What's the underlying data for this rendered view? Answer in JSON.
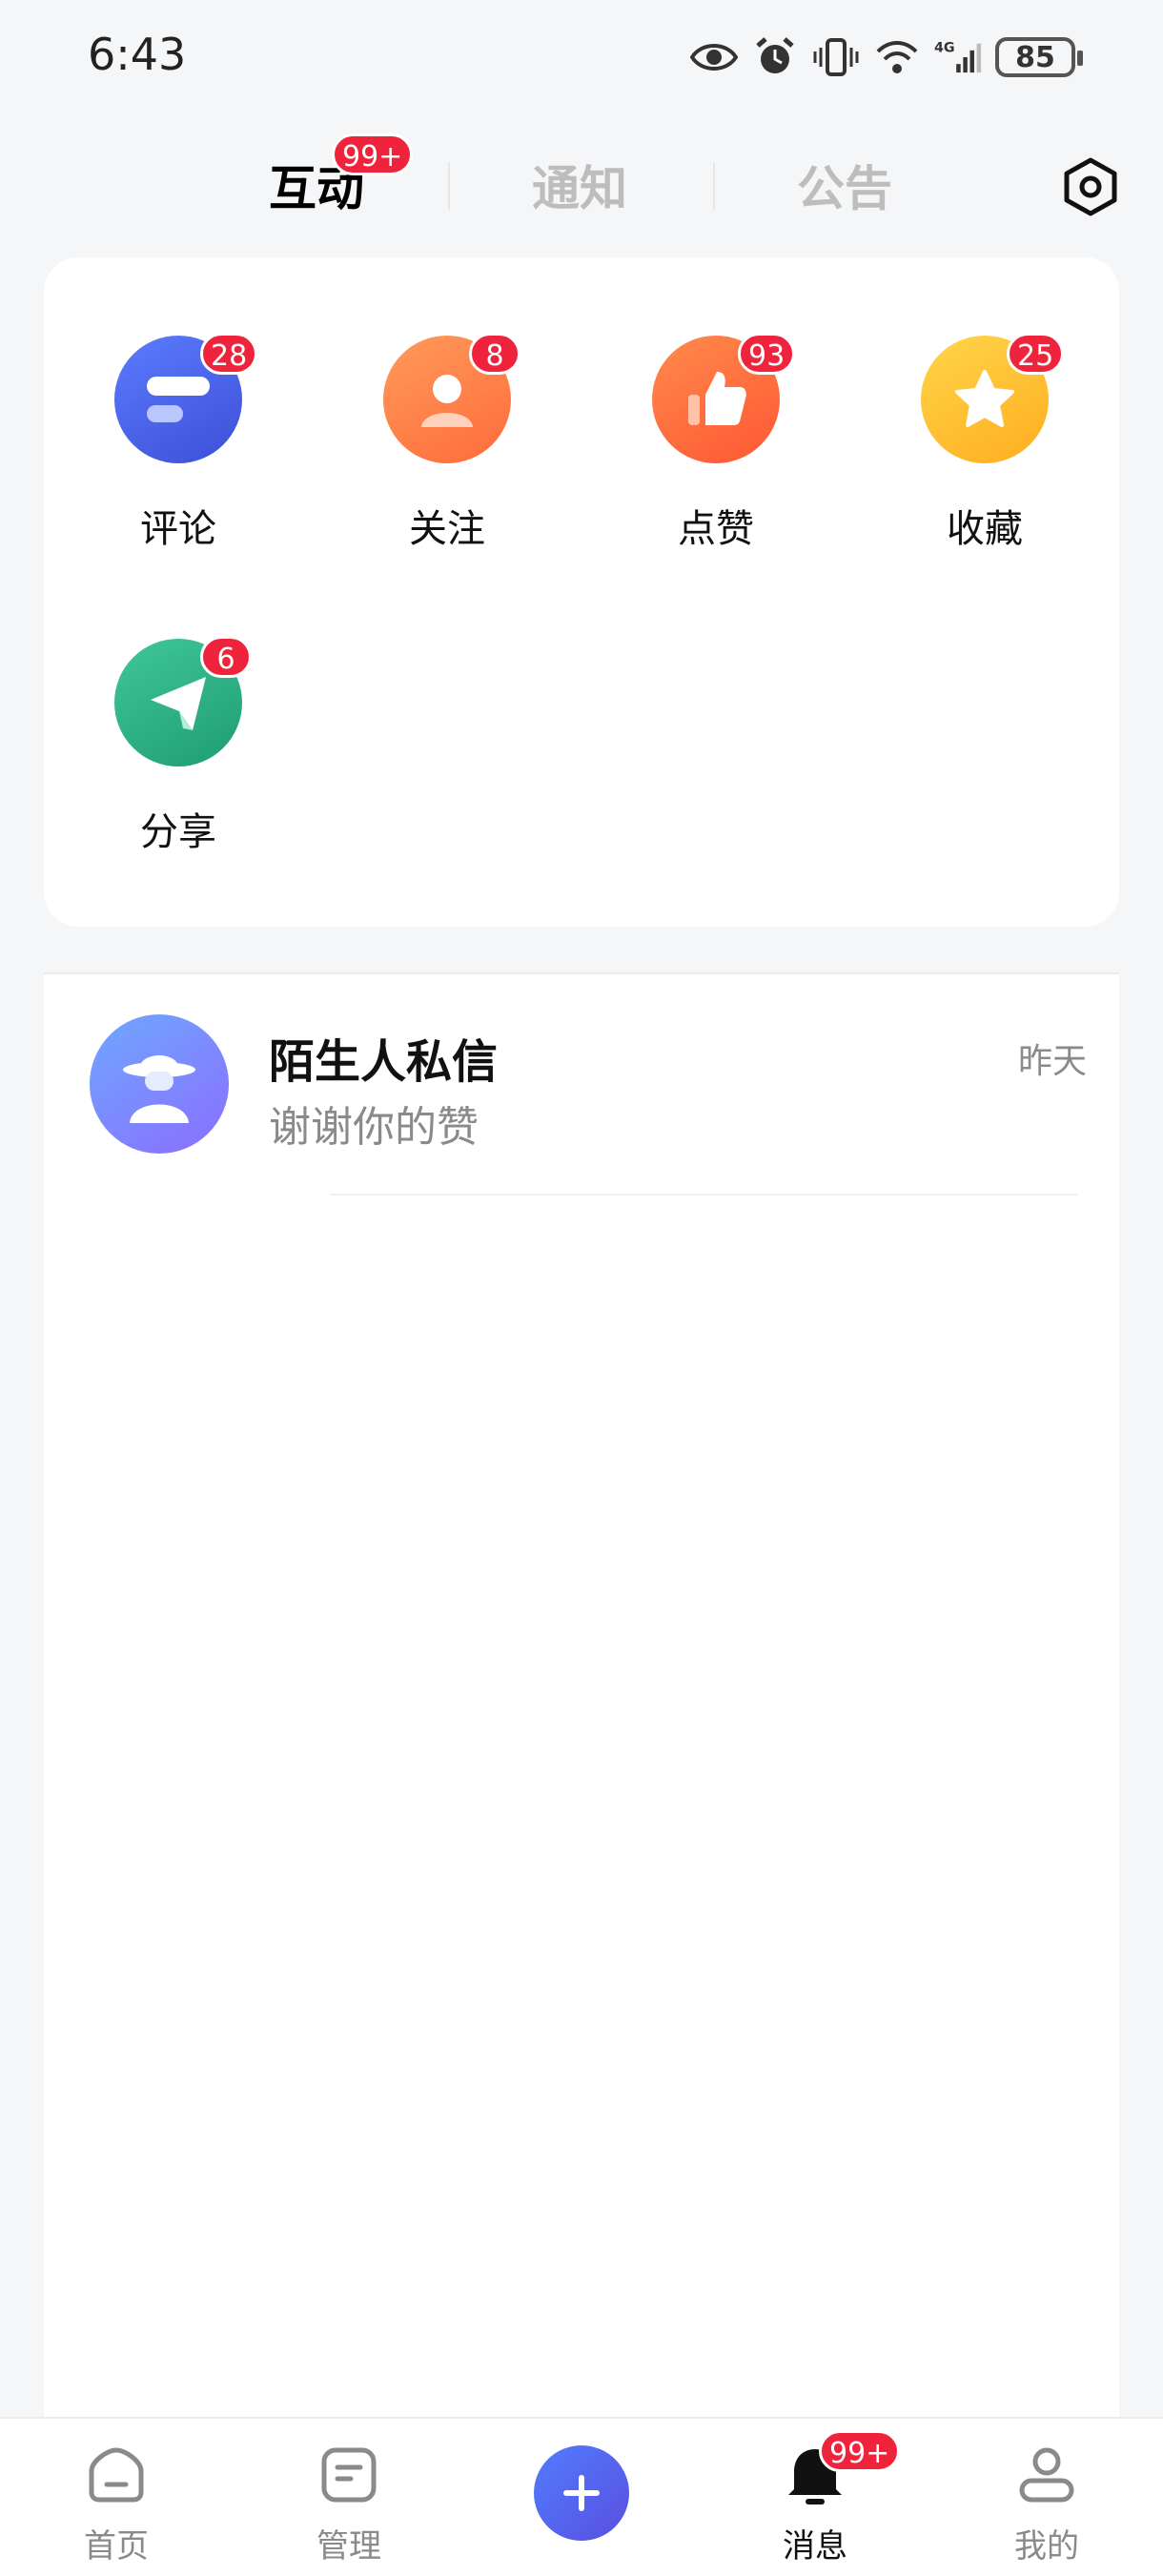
{
  "status_bar": {
    "time": "6:43",
    "battery": "85",
    "network": "4G",
    "icons": [
      "eye-icon",
      "alarm-icon",
      "vibrate-icon",
      "wifi-icon",
      "signal-icon",
      "battery-icon"
    ]
  },
  "top_tabs": {
    "active": "互动",
    "active_badge": "99+",
    "notify": "通知",
    "announce": "公告",
    "settings_icon": "settings-icon"
  },
  "categories": [
    {
      "label": "评论",
      "badge": "28",
      "icon": "comment-icon",
      "color": "#4a66e8"
    },
    {
      "label": "关注",
      "badge": "8",
      "icon": "follow-icon",
      "color": "#ff7a45"
    },
    {
      "label": "点赞",
      "badge": "93",
      "icon": "like-icon",
      "color": "#ff6a3d"
    },
    {
      "label": "收藏",
      "badge": "25",
      "icon": "favorite-icon",
      "color": "#ffc233"
    },
    {
      "label": "分享",
      "badge": "6",
      "icon": "share-icon",
      "color": "#2fb486"
    }
  ],
  "messages": [
    {
      "name": "陌生人私信",
      "preview": "谢谢你的赞",
      "time": "昨天",
      "icon": "stranger-avatar-icon"
    }
  ],
  "bottom_nav": {
    "home": "首页",
    "manage": "管理",
    "messages": "消息",
    "messages_badge": "99+",
    "mine": "我的",
    "add_icon": "plus-icon"
  }
}
